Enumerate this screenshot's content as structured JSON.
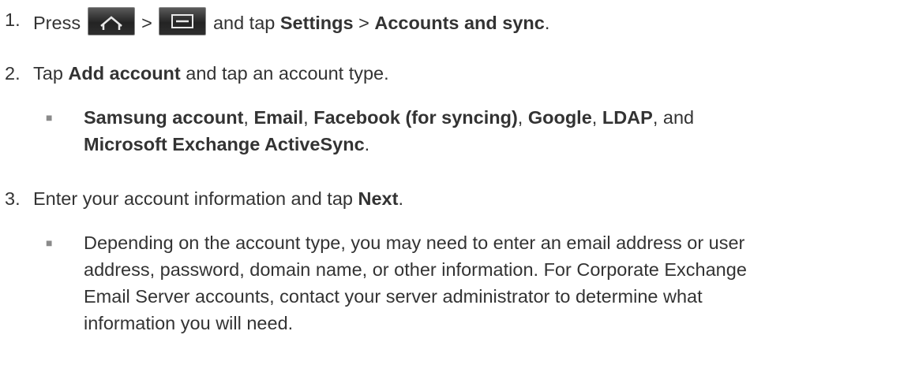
{
  "steps": [
    {
      "number": "1.",
      "parts": {
        "press": "Press",
        "gt1": ">",
        "and_tap": "and tap",
        "settings": "Settings",
        "gt2": ">",
        "accounts_sync": "Accounts and sync",
        "end": "."
      },
      "icons": [
        "home-key-icon",
        "menu-key-icon"
      ]
    },
    {
      "number": "2.",
      "parts": {
        "tap": "Tap",
        "add_account": "Add account",
        "rest": "and tap an account type."
      },
      "bullet": {
        "samsung": "Samsung account",
        "c1": ",",
        "email": "Email",
        "c2": ",",
        "facebook": "Facebook (for syncing)",
        "c3": ",",
        "google": "Google",
        "c4": ",",
        "ldap": "LDAP",
        "c5": ", and",
        "exchange": "Microsoft Exchange ActiveSync",
        "end": "."
      }
    },
    {
      "number": "3.",
      "parts": {
        "text": "Enter your account information and tap",
        "next": "Next",
        "end": "."
      },
      "bullet_lines": [
        "Depending on the account type, you may need to enter an email address or user",
        "address, password, domain name, or other information. For Corporate Exchange",
        "Email Server accounts, contact your server administrator to determine what",
        "information you will need."
      ]
    }
  ],
  "bullet_glyph": "■"
}
